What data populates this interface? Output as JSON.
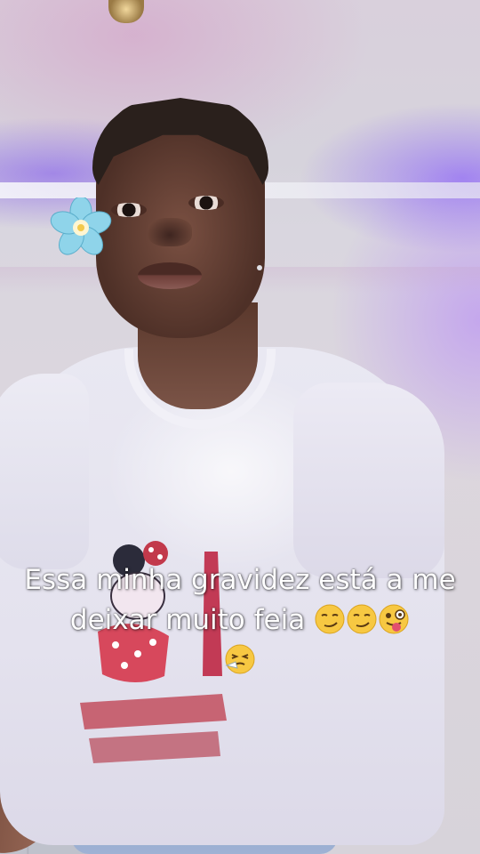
{
  "caption": {
    "text": "Essa minha gravidez está a me deixar muito feia",
    "emojis": [
      "smirking-face",
      "smirking-face",
      "winking-face-with-tongue",
      "sneezing-face"
    ]
  },
  "decoration": {
    "flower_color": "#7fd0e8",
    "accent_light": "#7a4cff"
  }
}
